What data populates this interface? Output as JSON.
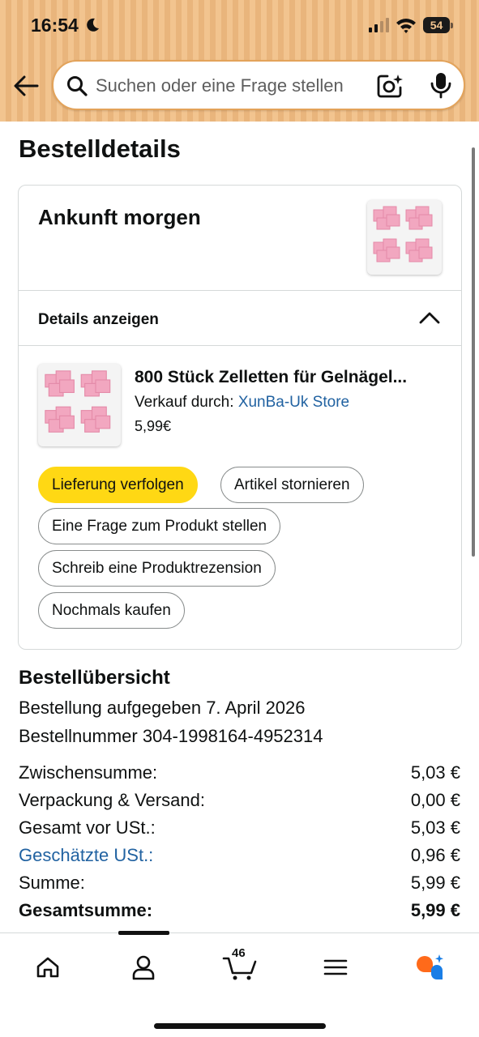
{
  "status_bar": {
    "time": "16:54",
    "battery": "54"
  },
  "search": {
    "placeholder": "Suchen oder eine Frage stellen"
  },
  "page_title": "Bestelldetails",
  "shipment": {
    "arrival": "Ankunft morgen",
    "details_label": "Details anzeigen",
    "item": {
      "title": "800 Stück Zelletten für Gelnägel...",
      "seller_prefix": "Verkauf durch:",
      "seller_name": "XunBa-Uk Store",
      "price": "5,99€"
    },
    "actions": [
      "Lieferung verfolgen",
      "Artikel stornieren",
      "Eine Frage zum Produkt stellen",
      "Schreib eine Produktrezension",
      "Nochmals kaufen"
    ]
  },
  "summary": {
    "title": "Bestellübersicht",
    "placed": "Bestellung aufgegeben 7. April 2026",
    "order_number": "Bestellnummer 304-1998164-4952314",
    "rows": [
      {
        "label": "Zwischensumme:",
        "value": "5,03 €"
      },
      {
        "label": "Verpackung & Versand:",
        "value": "0,00 €"
      },
      {
        "label": "Gesamt vor USt.:",
        "value": "5,03 €"
      },
      {
        "label": "Geschätzte USt.:",
        "value": "0,96 €"
      },
      {
        "label": "Summe:",
        "value": "5,99 €"
      },
      {
        "label": "Gesamtsumme:",
        "value": "5,99 €"
      }
    ]
  },
  "bottom_nav": {
    "items": [
      "home-icon",
      "account-icon",
      "cart-icon",
      "menu-icon",
      "rufus-icon"
    ],
    "cart_count": "46"
  },
  "colors": {
    "accent": "#ffd814",
    "link": "#2162a1",
    "header": "#f2c48f",
    "rufus": "#ff6a1a"
  }
}
